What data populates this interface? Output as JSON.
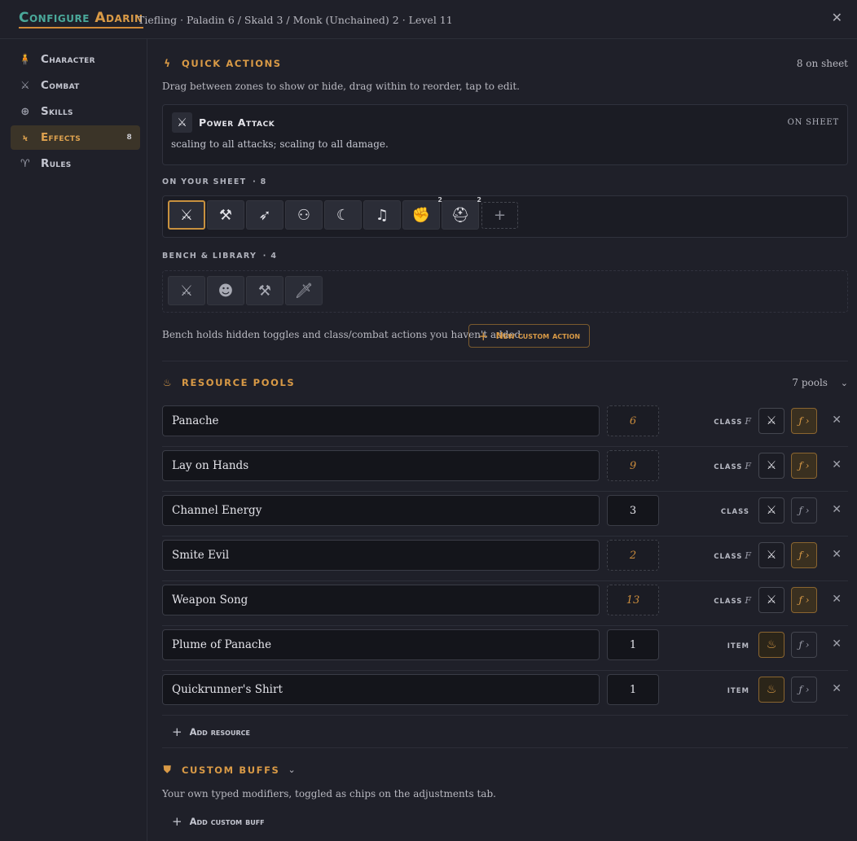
{
  "header": {
    "title_prefix": "Configure",
    "title_name": "Adarin",
    "subtitle": "Tiefling · Paladin 6 / Skald 3 / Monk (Unchained) 2 · Level 11",
    "close_glyph": "✕"
  },
  "sidebar": {
    "items": [
      {
        "label": "Character",
        "icon": "person-icon",
        "glyph": "🧍"
      },
      {
        "label": "Combat",
        "icon": "crossed-swords-icon",
        "glyph": "⚔"
      },
      {
        "label": "Skills",
        "icon": "crosshair-icon",
        "glyph": "⊕"
      },
      {
        "label": "Effects",
        "icon": "lightning-icon",
        "glyph": "ϟ",
        "count": "8",
        "active": true
      },
      {
        "label": "Rules",
        "icon": "ram-skull-icon",
        "glyph": "♈"
      }
    ]
  },
  "quick_actions": {
    "title": "QUICK ACTIONS",
    "count_note": "8 on sheet",
    "description": "Drag between zones to show or hide, drag within to reorder, tap to edit.",
    "selected": {
      "name": "Power Attack",
      "status": "ON SHEET",
      "text": "scaling to all attacks; scaling to all damage."
    },
    "on_sheet_label": "ON YOUR SHEET",
    "on_sheet_count": "8",
    "on_sheet_tiles": [
      {
        "icon": "power-attack-icon",
        "glyph": "⚔",
        "selected": true
      },
      {
        "icon": "axe-strike-icon",
        "glyph": "⚒"
      },
      {
        "icon": "charge-runner-icon",
        "glyph": "➶"
      },
      {
        "icon": "twin-figures-icon",
        "glyph": "⚇"
      },
      {
        "icon": "crescent-slash-icon",
        "glyph": "☾"
      },
      {
        "icon": "lyre-icon",
        "glyph": "♫"
      },
      {
        "icon": "flurry-fist-icon",
        "glyph": "✊",
        "badge": "2"
      },
      {
        "icon": "winged-helm-icon",
        "glyph": "⛑",
        "badge": "2"
      }
    ],
    "add_glyph": "+",
    "bench_label": "BENCH & LIBRARY",
    "bench_count": "4",
    "bench_tiles": [
      {
        "icon": "crossed-blades-icon",
        "glyph": "⚔"
      },
      {
        "icon": "alien-mask-icon",
        "glyph": "☻"
      },
      {
        "icon": "axe-icon",
        "glyph": "⚒"
      },
      {
        "icon": "dagger-icon",
        "glyph": "🗡"
      }
    ],
    "bench_note": "Bench holds hidden toggles and class/combat actions you haven't added.",
    "new_action_label": "New custom action"
  },
  "resource_pools": {
    "title": "RESOURCE POOLS",
    "count_note": "7 pools",
    "add_label": "Add resource",
    "rows": [
      {
        "name": "Panache",
        "value": "6",
        "formula": true,
        "tag": "CLASS",
        "tag_f": "F",
        "icon": "crossed-swords-icon",
        "icon_glyph": "⚔",
        "icon_gold": false,
        "fx_on": true
      },
      {
        "name": "Lay on Hands",
        "value": "9",
        "formula": true,
        "tag": "CLASS",
        "tag_f": "F",
        "icon": "crossed-swords-icon",
        "icon_glyph": "⚔",
        "icon_gold": false,
        "fx_on": true
      },
      {
        "name": "Channel Energy",
        "value": "3",
        "formula": false,
        "tag": "CLASS",
        "tag_f": "",
        "icon": "crossed-swords-icon",
        "icon_glyph": "⚔",
        "icon_gold": false,
        "fx_on": false
      },
      {
        "name": "Smite Evil",
        "value": "2",
        "formula": true,
        "tag": "CLASS",
        "tag_f": "F",
        "icon": "crossed-swords-icon",
        "icon_glyph": "⚔",
        "icon_gold": false,
        "fx_on": true
      },
      {
        "name": "Weapon Song",
        "value": "13",
        "formula": true,
        "tag": "CLASS",
        "tag_f": "F",
        "icon": "crossed-swords-icon",
        "icon_glyph": "⚔",
        "icon_gold": false,
        "fx_on": true
      },
      {
        "name": "Plume of Panache",
        "value": "1",
        "formula": false,
        "tag": "ITEM",
        "tag_f": "",
        "icon": "flask-icon",
        "icon_glyph": "♨",
        "icon_gold": true,
        "fx_on": false
      },
      {
        "name": "Quickrunner's Shirt",
        "value": "1",
        "formula": false,
        "tag": "ITEM",
        "tag_f": "",
        "icon": "flask-icon",
        "icon_glyph": "♨",
        "icon_gold": true,
        "fx_on": false
      }
    ],
    "fx_glyph": "ƒ ›",
    "remove_glyph": "✕"
  },
  "custom_buffs": {
    "title": "CUSTOM BUFFS",
    "description": "Your own typed modifiers, toggled as chips on the adjustments tab.",
    "add_label": "Add custom buff"
  },
  "colors": {
    "accent": "#d99a46",
    "teal": "#4aa89a",
    "background": "#1f2029"
  }
}
